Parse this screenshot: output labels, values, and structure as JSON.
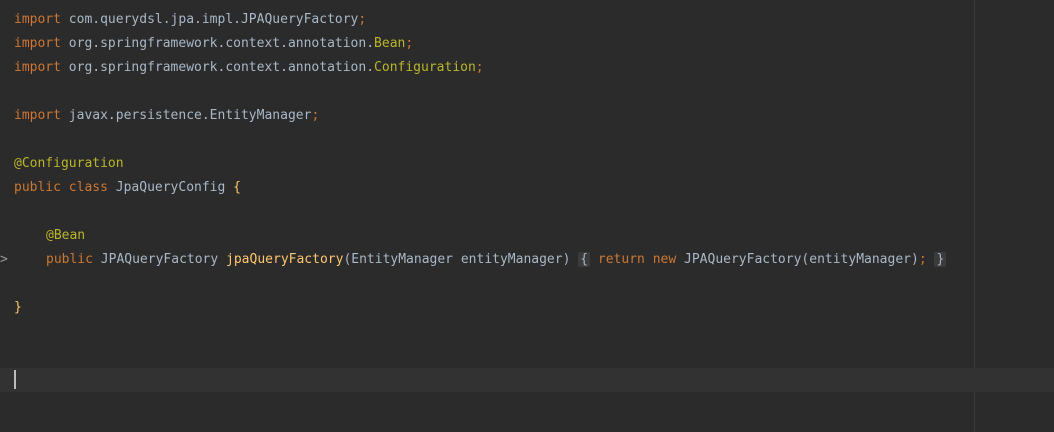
{
  "code": {
    "line1": {
      "kw": "import",
      "pkg": "com.querydsl.jpa.impl.JPAQueryFactory",
      "semi": ";"
    },
    "line2": {
      "kw": "import",
      "pkg": "org.springframework.context.annotation.",
      "cls": "Bean",
      "semi": ";"
    },
    "line3": {
      "kw": "import",
      "pkg": "org.springframework.context.annotation.",
      "cls": "Configuration",
      "semi": ";"
    },
    "line5": {
      "kw": "import",
      "pkg": "javax.persistence.EntityManager",
      "semi": ";"
    },
    "line7": {
      "annotation": "@Configuration"
    },
    "line8": {
      "kw1": "public",
      "kw2": "class",
      "name": "JpaQueryConfig",
      "brace": "{"
    },
    "line10": {
      "annotation": "@Bean"
    },
    "line11": {
      "kw": "public",
      "type": "JPAQueryFactory",
      "method": "jpaQueryFactory",
      "params": "(EntityManager entityManager)",
      "fold_open": "{",
      "ret": "return",
      "new_kw": "new",
      "ctor": "JPAQueryFactory(entityManager)",
      "semi": ";",
      "fold_close": "}"
    },
    "line13": {
      "brace": "}"
    }
  },
  "gutter": {
    "fold_marker": ">"
  },
  "colors": {
    "background": "#2b2b2b",
    "keyword": "#cc7832",
    "text": "#a9b7c6",
    "annotation": "#bbb529",
    "method": "#ffc66d",
    "current_line": "#323232"
  }
}
